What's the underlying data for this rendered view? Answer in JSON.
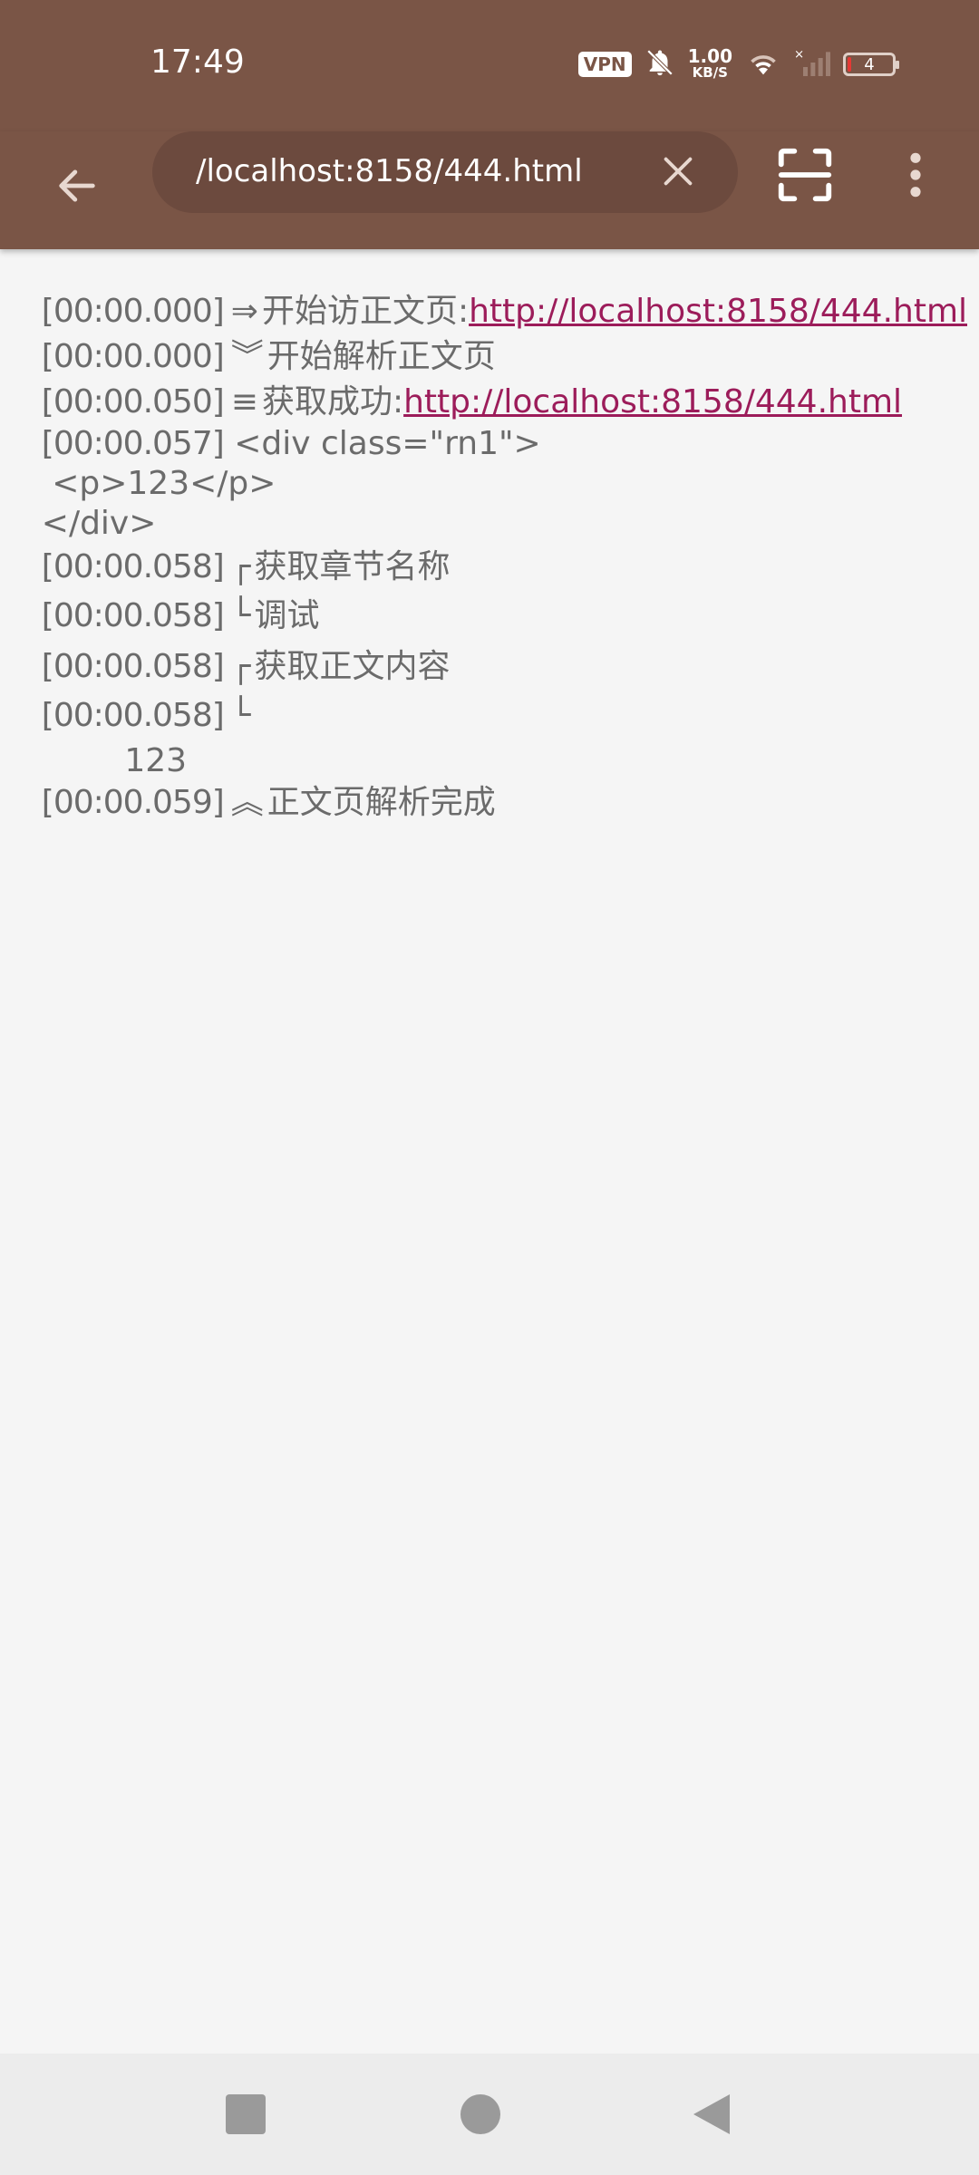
{
  "status_bar": {
    "time": "17:49",
    "vpn": "VPN",
    "net_speed_value": "1.00",
    "net_speed_unit": "KB/S",
    "battery_level": "4"
  },
  "toolbar": {
    "url": "/localhost:8158/444.html"
  },
  "log": {
    "lines": [
      {
        "ts": "[00:00.000]",
        "sym": "⇒",
        "text": "开始访正文页:",
        "link": "http://localhost:8158/444.html"
      },
      {
        "ts": "[00:00.000]",
        "sym": "︾",
        "text": "开始解析正文页"
      },
      {
        "ts": "[00:00.050]",
        "sym": "≡",
        "text": "获取成功:",
        "link": "http://localhost:8158/444.html"
      },
      {
        "ts": "[00:00.057]",
        "text": " <div class=\"rn1\">"
      },
      {
        "text": " <p>123</p>"
      },
      {
        "text": "</div>"
      },
      {
        "ts": "[00:00.058]",
        "sym": "┌",
        "text": "获取章节名称"
      },
      {
        "ts": "[00:00.058]",
        "sym": "└",
        "text": "调试"
      },
      {
        "ts": "[00:00.058]",
        "sym": "┌",
        "text": "获取正文内容"
      },
      {
        "ts": "[00:00.058]",
        "sym": "└",
        "text": ""
      },
      {
        "text": "        123"
      },
      {
        "ts": "[00:00.059]",
        "sym": "︽",
        "text": "正文页解析完成"
      }
    ]
  }
}
